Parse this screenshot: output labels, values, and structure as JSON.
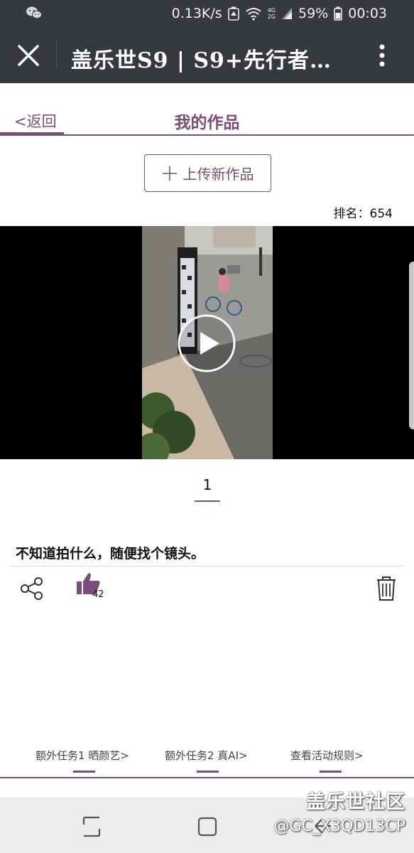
{
  "status_bar": {
    "network_speed": "0.13K/s",
    "network_type_top": "4G",
    "network_type_bottom": "2G",
    "battery": "59%",
    "time": "00:03"
  },
  "app_bar": {
    "title": "盖乐世S9 | S9+先行者…"
  },
  "header": {
    "back_label": "<返回",
    "page_title": "我的作品"
  },
  "upload_button": {
    "label": "上传新作品"
  },
  "rank": {
    "text": "排名：654"
  },
  "pager": {
    "current": "1"
  },
  "post": {
    "description": "不知道拍什么，随便找个镜头。",
    "like_count": "42"
  },
  "bottom_links": [
    {
      "label": "额外任务1 晒颜艺>"
    },
    {
      "label": "额外任务2 真AI>"
    },
    {
      "label": "查看活动规则>"
    }
  ],
  "watermark": {
    "line1": "盖乐世社区",
    "line2": "@GC_X3QD13CP"
  },
  "colors": {
    "accent": "#7a4e7a",
    "topbar": "#36393d",
    "navbar": "#ececec"
  },
  "icons": [
    "wechat-icon",
    "close-icon",
    "more-vert-icon",
    "plus-icon",
    "play-icon",
    "share-icon",
    "thumbs-up-icon",
    "trash-icon",
    "recent-apps-icon",
    "home-icon",
    "back-icon"
  ]
}
